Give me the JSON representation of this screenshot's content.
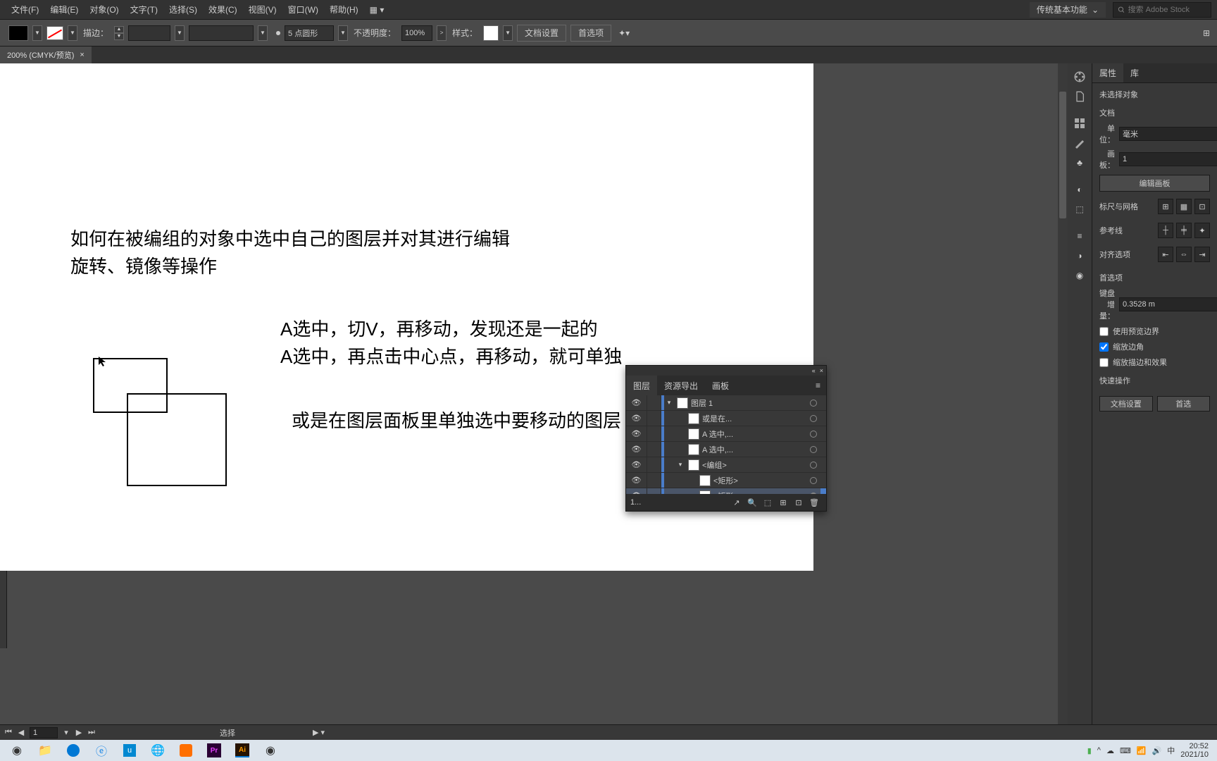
{
  "menu": {
    "file": "文件(F)",
    "edit": "编辑(E)",
    "object": "对象(O)",
    "type": "文字(T)",
    "select": "选择(S)",
    "effect": "效果(C)",
    "view": "视图(V)",
    "window": "窗口(W)",
    "help": "帮助(H)"
  },
  "workspace": "传统基本功能",
  "search_placeholder": "搜索 Adobe Stock",
  "options": {
    "stroke_label": "描边：",
    "stroke_value": "",
    "brush_value": "5 点圆形",
    "opacity_label": "不透明度：",
    "opacity_value": "100%",
    "style_label": "样式：",
    "doc_setup": "文档设置",
    "prefs": "首选项"
  },
  "doc_tab": "200% (CMYK/预览)",
  "canvas_text": {
    "line1": "如何在被编组的对象中选中自己的图层并对其进行编辑",
    "line2": "旋转、镜像等操作",
    "line3": "A选中，切V，再移动，发现还是一起的",
    "line4": "A选中，再点击中心点，再移动，就可单独",
    "line5": "或是在图层面板里单独选中要移动的图层"
  },
  "properties": {
    "tab_properties": "属性",
    "tab_library": "库",
    "no_selection": "未选择对象",
    "section_doc": "文档",
    "units_label": "单位：",
    "units_value": "毫米",
    "artboard_label": "画板：",
    "artboard_value": "1",
    "edit_artboard": "编辑画板",
    "section_ruler": "标尺与网格",
    "section_guides": "参考线",
    "section_align": "对齐选项",
    "section_prefs": "首选项",
    "key_increment_label": "键盘增量：",
    "key_increment_value": "0.3528 m",
    "use_preview": "使用预览边界",
    "scale_corners": "缩放边角",
    "scale_strokes": "缩放描边和效果",
    "section_quick": "快速操作",
    "quick_doc": "文档设置",
    "quick_pref": "首选"
  },
  "layers": {
    "tab_layers": "图层",
    "tab_export": "资源导出",
    "tab_artboards": "画板",
    "items": [
      {
        "name": "图层 1",
        "indent": 0,
        "twisty": "▾",
        "eye": true
      },
      {
        "name": "或是在...",
        "indent": 1,
        "twisty": "",
        "eye": true
      },
      {
        "name": "A 选中,...",
        "indent": 1,
        "twisty": "",
        "eye": true
      },
      {
        "name": "A 选中,...",
        "indent": 1,
        "twisty": "",
        "eye": true
      },
      {
        "name": "<编组>",
        "indent": 1,
        "twisty": "▾",
        "eye": true
      },
      {
        "name": "<矩形>",
        "indent": 2,
        "twisty": "",
        "eye": true
      },
      {
        "name": "<矩形>",
        "indent": 2,
        "twisty": "",
        "eye": true,
        "selected": true,
        "filled": true
      }
    ],
    "footer_count": "1..."
  },
  "status": {
    "artboard": "1",
    "tool": "选择"
  },
  "tray": {
    "time": "20:52",
    "date": "2021/10",
    "ime": "中"
  }
}
